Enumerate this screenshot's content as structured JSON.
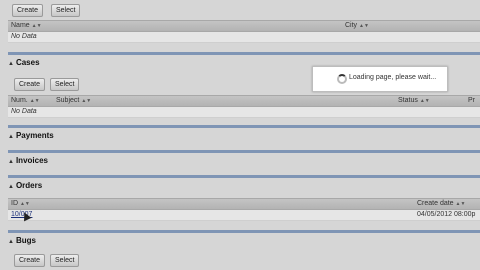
{
  "top_section": {
    "create_label": "Create",
    "select_label": "Select",
    "columns": [
      "Name",
      "City"
    ],
    "empty_text": "No Data"
  },
  "cases": {
    "title": "Cases",
    "create_label": "Create",
    "select_label": "Select",
    "columns": [
      "Num.",
      "Subject",
      "Status",
      "Pr"
    ],
    "empty_text": "No Data"
  },
  "payments": {
    "title": "Payments"
  },
  "invoices": {
    "title": "Invoices"
  },
  "orders": {
    "title": "Orders",
    "columns": [
      "ID",
      "Create date"
    ],
    "rows": [
      {
        "id": "10/007",
        "create_date": "04/05/2012 08:00p"
      }
    ]
  },
  "bugs": {
    "title": "Bugs",
    "create_label": "Create",
    "select_label": "Select"
  },
  "loading": {
    "text": "Loading page, please wait..."
  },
  "icons": {
    "collapse": "collapse-triangle-icon",
    "sort": "sort-arrows-icon",
    "spinner": "spinner-icon"
  }
}
